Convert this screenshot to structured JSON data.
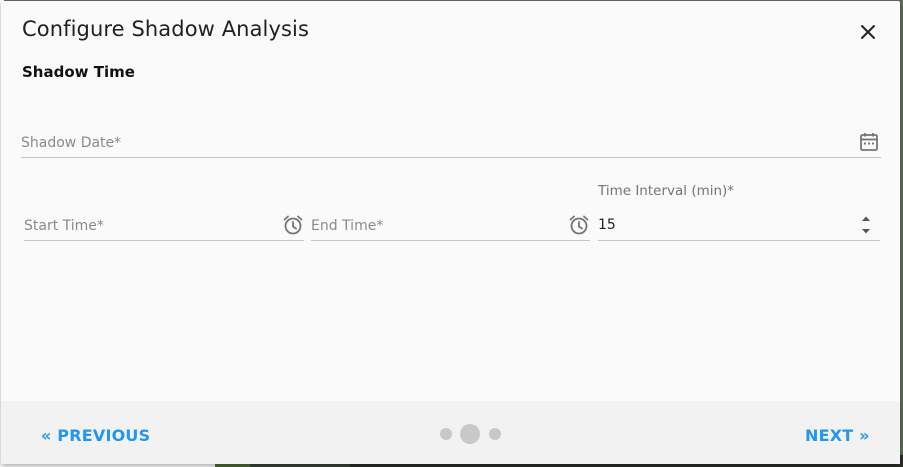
{
  "dialog": {
    "title": "Configure Shadow Analysis",
    "close_icon": "close-icon",
    "section_title": "Shadow Time"
  },
  "fields": {
    "shadow_date": {
      "placeholder": "Shadow Date*",
      "icon": "calendar-icon"
    },
    "start_time": {
      "placeholder": "Start Time*",
      "icon": "alarm-clock-icon"
    },
    "end_time": {
      "placeholder": "End Time*",
      "icon": "alarm-clock-icon"
    },
    "time_interval": {
      "label": "Time Interval (min)*",
      "value": "15",
      "icon": "spinner-arrows-icon"
    }
  },
  "footer": {
    "previous_label": "« PREVIOUS",
    "next_label": "NEXT »",
    "steps_total": 3,
    "current_step": 2
  },
  "colors": {
    "accent": "#2196f3",
    "icon": "#757575"
  }
}
